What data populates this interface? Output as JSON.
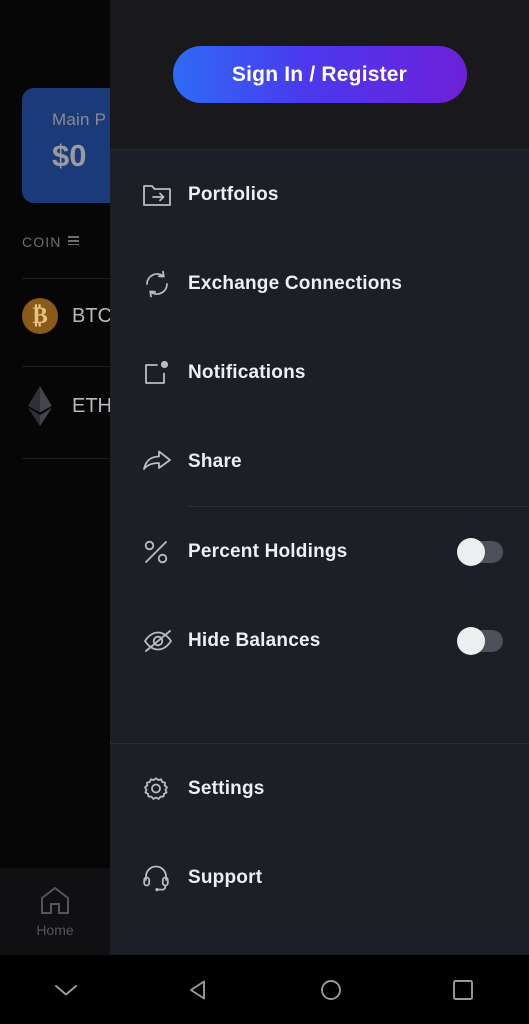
{
  "background_app": {
    "portfolio_card": {
      "title": "Main P",
      "value": "$0"
    },
    "table_header": {
      "coin_label": "COIN",
      "sort_icon": "list-icon"
    },
    "coins": [
      {
        "symbol": "BTC",
        "icon": "bitcoin-icon"
      },
      {
        "symbol": "ETH",
        "icon": "ethereum-icon"
      }
    ],
    "tabbar": {
      "home_label": "Home",
      "home_icon": "house-icon"
    }
  },
  "drawer": {
    "header": {
      "signin_label": "Sign In / Register"
    },
    "menu_primary": [
      {
        "label": "Portfolios",
        "icon": "folder-arrow-icon"
      },
      {
        "label": "Exchange Connections",
        "icon": "refresh-sync-icon"
      },
      {
        "label": "Notifications",
        "icon": "notification-square-dot-icon"
      },
      {
        "label": "Share",
        "icon": "share-arrow-icon"
      }
    ],
    "menu_toggles": [
      {
        "label": "Percent Holdings",
        "icon": "percent-icon",
        "state": "off"
      },
      {
        "label": "Hide Balances",
        "icon": "eye-slash-icon",
        "state": "off"
      }
    ],
    "menu_footer": [
      {
        "label": "Settings",
        "icon": "gear-icon"
      },
      {
        "label": "Support",
        "icon": "headset-icon"
      }
    ]
  },
  "navbar": {
    "buttons": [
      {
        "name": "dismiss-keyboard",
        "icon": "chevron-down-icon"
      },
      {
        "name": "back",
        "icon": "triangle-left-icon"
      },
      {
        "name": "home",
        "icon": "circle-icon"
      },
      {
        "name": "recents",
        "icon": "square-icon"
      }
    ]
  },
  "colors": {
    "drawer_bg": "#1c2026",
    "header_bg": "#19191b",
    "accent_blue": "#2f6bf5",
    "accent_purple": "#6d20d8",
    "portfolio_card": "#1b3a7a",
    "bitcoin_orange": "#8a5a19",
    "divider": "#2a2e35"
  }
}
